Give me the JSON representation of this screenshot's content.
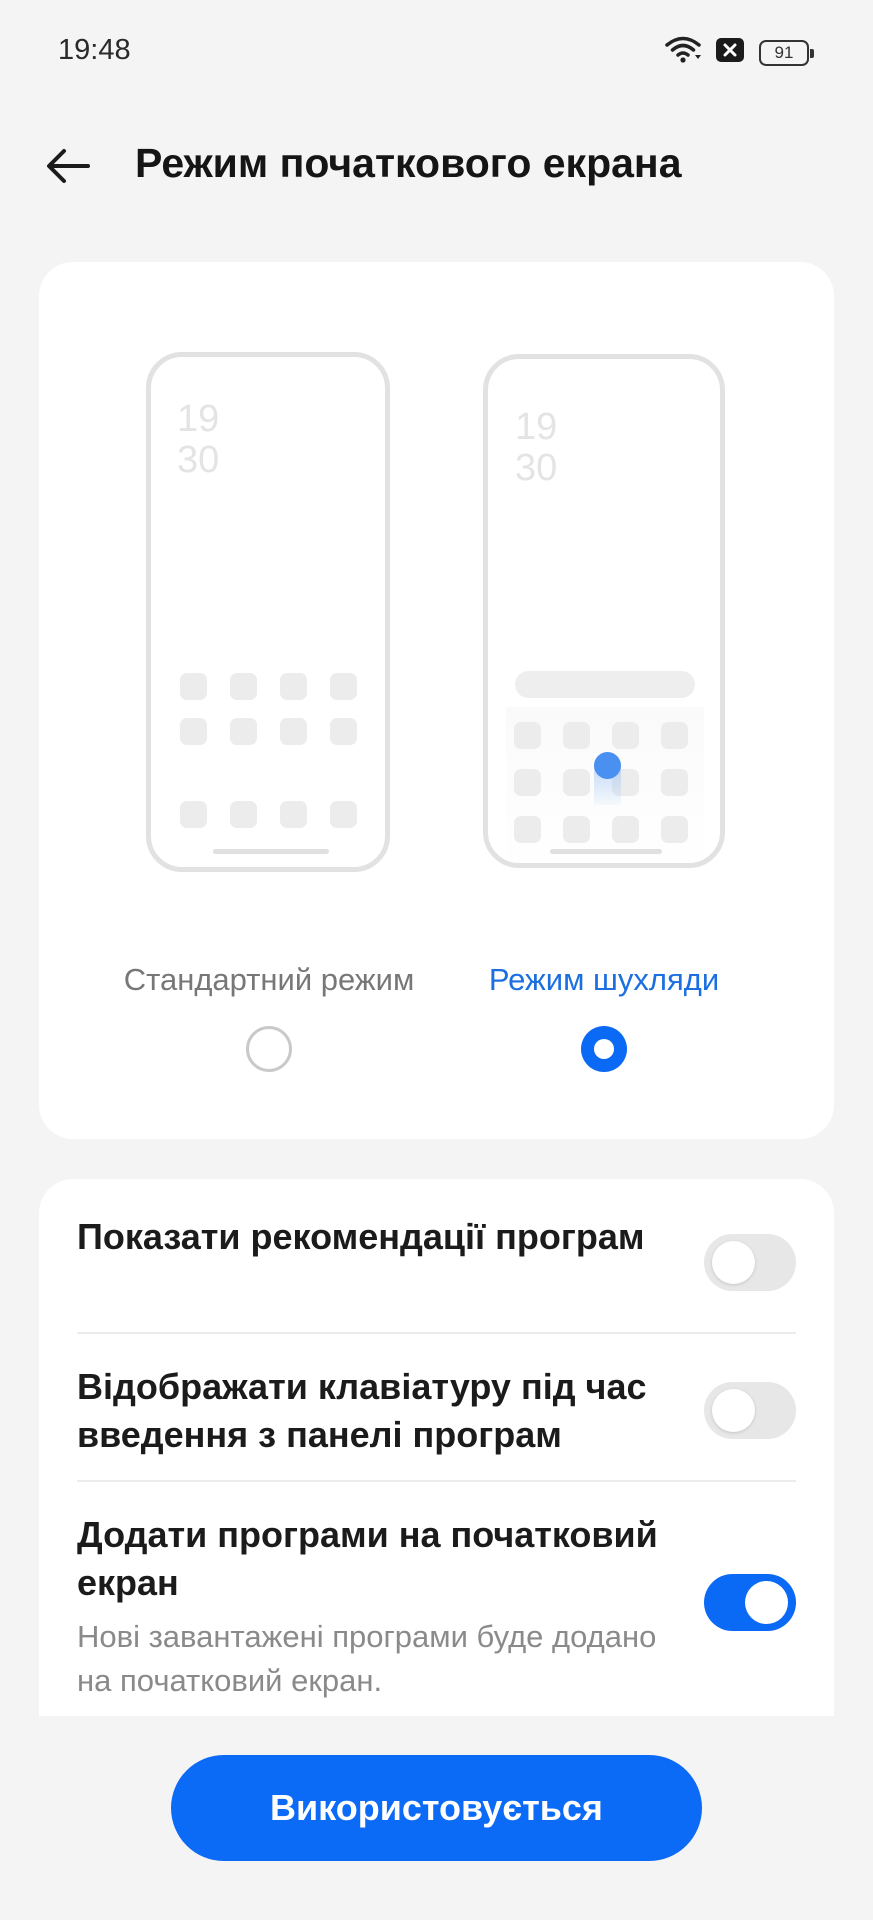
{
  "status_bar": {
    "time": "19:48",
    "battery_level": "91",
    "icons": [
      "wifi-icon",
      "notification-blocked-icon",
      "battery-icon"
    ]
  },
  "header": {
    "title": "Режим початкового екрана",
    "back_icon": "arrow-left-icon"
  },
  "preview": {
    "standard_clock": {
      "hours": "19",
      "minutes": "30"
    },
    "drawer_clock": {
      "hours": "19",
      "minutes": "30"
    }
  },
  "modes": {
    "standard": {
      "label": "Стандартний режим",
      "selected": false
    },
    "drawer": {
      "label": "Режим шухляди",
      "selected": true
    }
  },
  "settings": [
    {
      "title": "Показати рекомендації програм",
      "enabled": false
    },
    {
      "title": "Відображати клавіатуру під час введення з панелі програм",
      "enabled": false
    },
    {
      "title": "Додати програми на початковий екран",
      "description": "Нові завантажені програми буде додано на початковий екран.",
      "enabled": true
    }
  ],
  "primary_button": {
    "label": "Використовується"
  },
  "colors": {
    "accent": "#0A6AF5",
    "background": "#F4F4F4",
    "card": "#FFFFFF",
    "selected_label": "#1B6FE0",
    "unselected_label": "#777777"
  }
}
